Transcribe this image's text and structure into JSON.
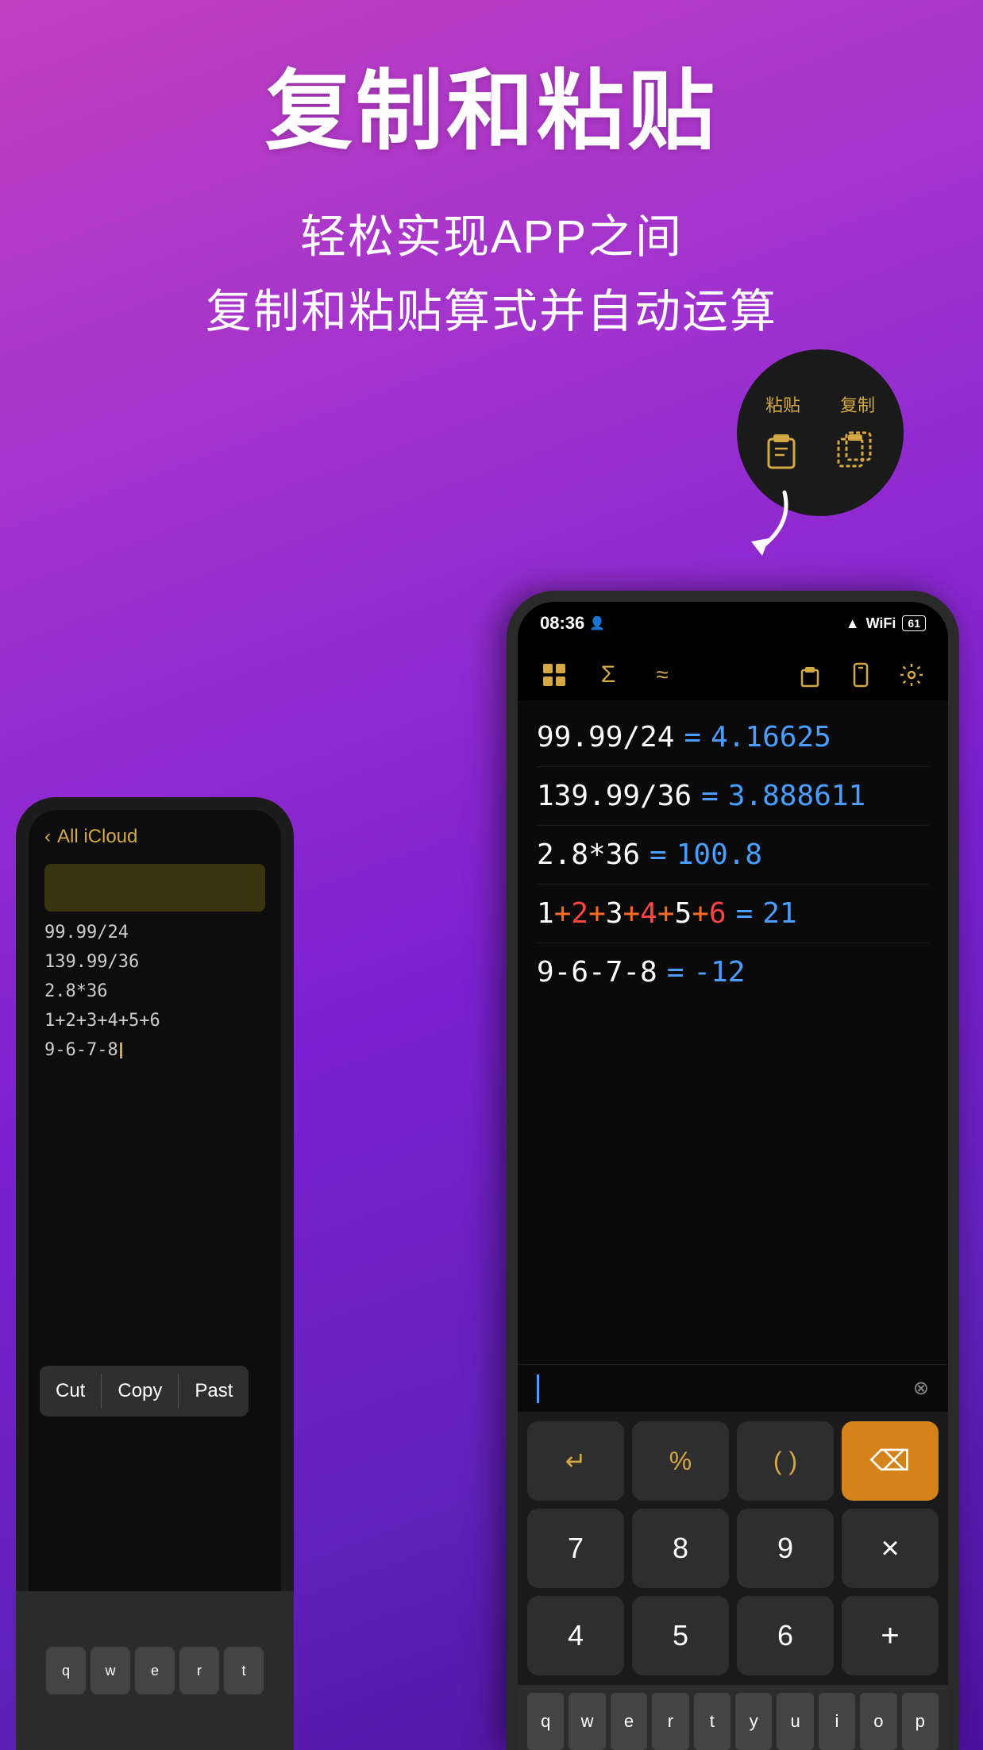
{
  "header": {
    "main_title": "复制和粘贴",
    "sub_title_1": "轻松实现APP之间",
    "sub_title_2": "复制和粘贴算式并自动运算"
  },
  "badge": {
    "label_paste": "粘贴",
    "label_copy": "复制"
  },
  "back_phone": {
    "nav_label": "< All iCloud",
    "items": [
      "99.99/24",
      "139.99/36",
      "2.8*36",
      "1+2+3+4+5+6",
      "9-6-7-8"
    ],
    "context_menu": [
      "Cut",
      "Copy",
      "Past"
    ]
  },
  "front_phone": {
    "status_time": "08:36",
    "status_signal": "▲",
    "battery": "61",
    "calculations": [
      {
        "expr": "99.99/24",
        "eq": "=",
        "result": "4.16625"
      },
      {
        "expr": "139.99/36",
        "eq": "=",
        "result": "3.888611"
      },
      {
        "expr": "2.8*36",
        "eq": "=",
        "result": "100.8"
      },
      {
        "expr": "1+2+3+4+5+6",
        "eq": "=",
        "result": "21",
        "colored": true
      },
      {
        "expr": "9-6-7-8",
        "eq": "=",
        "result": "-12"
      }
    ],
    "keypad": {
      "row1": [
        "↵",
        "%",
        "( )",
        "⌫"
      ],
      "row2": [
        "7",
        "8",
        "9",
        "×"
      ],
      "row3": [
        "4",
        "5",
        "6",
        "+"
      ]
    },
    "bottom_keys": [
      "q",
      "w",
      "e",
      "r",
      "t",
      "y",
      "u",
      "i",
      "o",
      "p"
    ]
  }
}
